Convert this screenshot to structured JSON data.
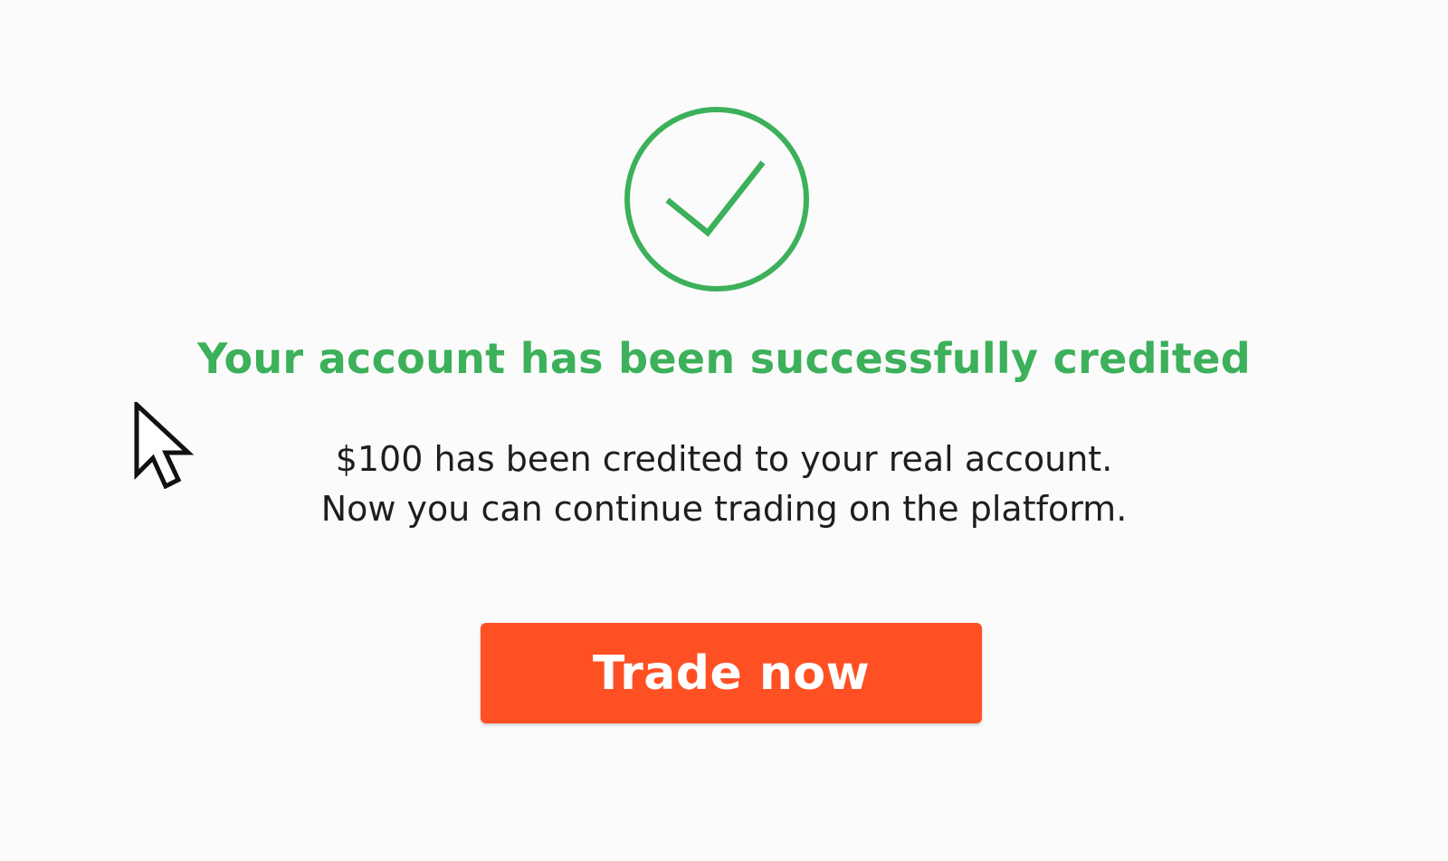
{
  "dialog": {
    "title": "Your account has been successfully credited",
    "message_line1": "$100 has been credited to your real account.",
    "message_line2": "Now you can continue trading on the platform.",
    "button_label": "Trade now"
  },
  "icons": {
    "status": "check-circle-icon",
    "pointer": "mouse-cursor-icon"
  },
  "colors": {
    "success": "#3cb05a",
    "button": "#ff5024",
    "text": "#1e1e1e",
    "background": "#fbfbfb"
  }
}
